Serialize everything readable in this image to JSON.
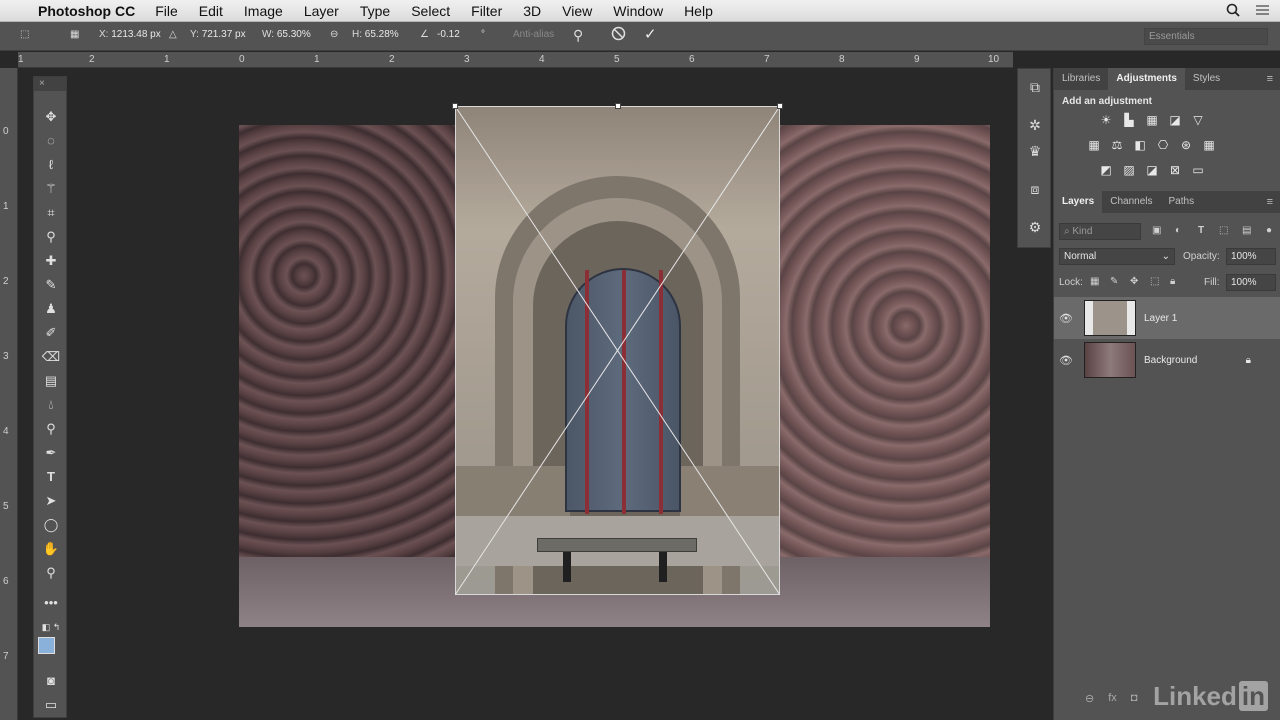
{
  "menubar": {
    "app": "Photoshop CC",
    "items": [
      "File",
      "Edit",
      "Image",
      "Layer",
      "Type",
      "Select",
      "Filter",
      "3D",
      "View",
      "Window",
      "Help"
    ]
  },
  "options": {
    "x_label": "X:",
    "x_value": "1213.48 px",
    "y_label": "Y:",
    "y_value": "721.37 px",
    "w_label": "W:",
    "w_value": "65.30%",
    "h_label": "H:",
    "h_value": "65.28%",
    "angle_value": "-0.12",
    "angle_unit": "°",
    "anti_alias": "Anti-alias",
    "workspace": "Essentials"
  },
  "ruler_top": [
    "1",
    "2",
    "1",
    "0",
    "1",
    "2",
    "3",
    "4",
    "5",
    "6",
    "7",
    "8",
    "9",
    "10"
  ],
  "ruler_left": [
    "0",
    "1",
    "2",
    "3",
    "4",
    "5",
    "6",
    "7"
  ],
  "adjustments": {
    "tabs": [
      "Libraries",
      "Adjustments",
      "Styles"
    ],
    "active_tab": "Adjustments",
    "title": "Add an adjustment"
  },
  "layers": {
    "tabs": [
      "Layers",
      "Channels",
      "Paths"
    ],
    "active_tab": "Layers",
    "kind_placeholder": "Kind",
    "blend_mode": "Normal",
    "opacity_label": "Opacity:",
    "opacity_value": "100%",
    "lock_label": "Lock:",
    "fill_label": "Fill:",
    "fill_value": "100%",
    "items": [
      {
        "name": "Layer 1",
        "selected": true
      },
      {
        "name": "Background",
        "selected": false
      }
    ]
  },
  "watermark": {
    "text": "Linked",
    "suffix": "in"
  }
}
